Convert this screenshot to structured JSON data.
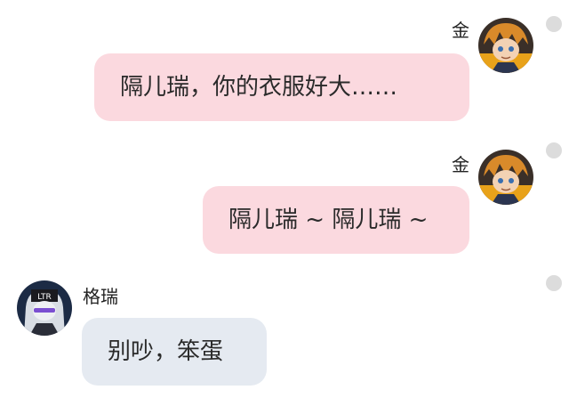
{
  "chat": {
    "messages": [
      {
        "side": "right",
        "sender": "金",
        "text": "隔儿瑞，你的衣服好大……",
        "avatar_icon": "kim-avatar-icon"
      },
      {
        "side": "right",
        "sender": "金",
        "text": "隔儿瑞 ~ 隔儿瑞 ~",
        "avatar_icon": "kim-avatar-icon"
      },
      {
        "side": "left",
        "sender": "格瑞",
        "text": "别吵，笨蛋",
        "avatar_icon": "grey-avatar-icon"
      }
    ]
  },
  "colors": {
    "right_bubble": "#fbd9df",
    "left_bubble": "#e5eaf1",
    "status_dot": "#dcdcdc"
  }
}
